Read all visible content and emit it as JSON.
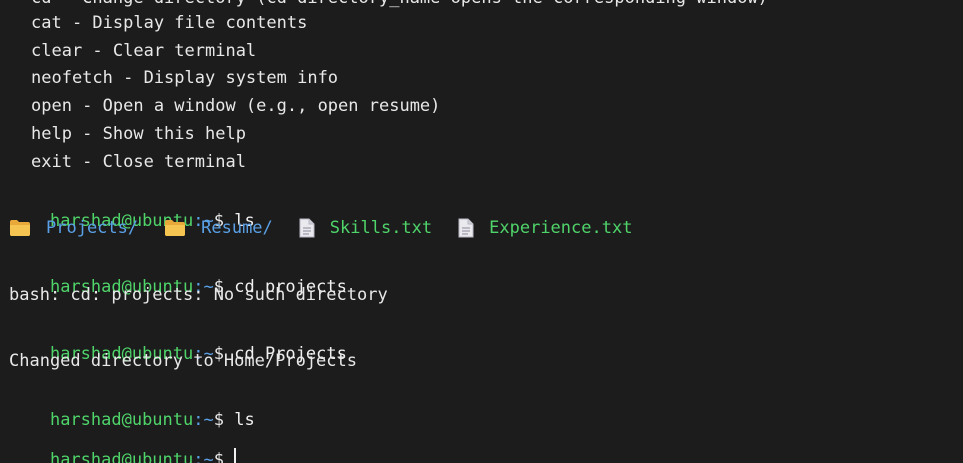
{
  "help": {
    "partial_top": "cd - Change directory (cd directory_name opens the corresponding window)",
    "lines": [
      "cat - Display file contents",
      "clear - Clear terminal",
      "neofetch - Display system info",
      "open - Open a window (e.g., open resume)",
      "help - Show this help",
      "exit - Close terminal"
    ]
  },
  "prompt": {
    "user_host": "harshad@ubuntu",
    "path": ":~",
    "sign": "$"
  },
  "history": [
    {
      "command": "ls"
    },
    {
      "command": "cd projects",
      "output": "bash: cd: projects: No such directory"
    },
    {
      "command": "cd Projects",
      "output": "Changed directory to Home/Projects"
    },
    {
      "command": "ls"
    }
  ],
  "ls_output": [
    {
      "name": "Projects/",
      "type": "folder",
      "icon": "folder-icon"
    },
    {
      "name": "Resume/",
      "type": "folder",
      "icon": "folder-icon"
    },
    {
      "name": "Skills.txt",
      "type": "file",
      "icon": "file-icon"
    },
    {
      "name": "Experience.txt",
      "type": "file",
      "icon": "file-icon"
    }
  ],
  "colors": {
    "background": "#1c1c1c",
    "prompt_user": "#4fd46a",
    "directory": "#5aa0e6",
    "file": "#4fd46a",
    "text": "#e8e8e8"
  }
}
